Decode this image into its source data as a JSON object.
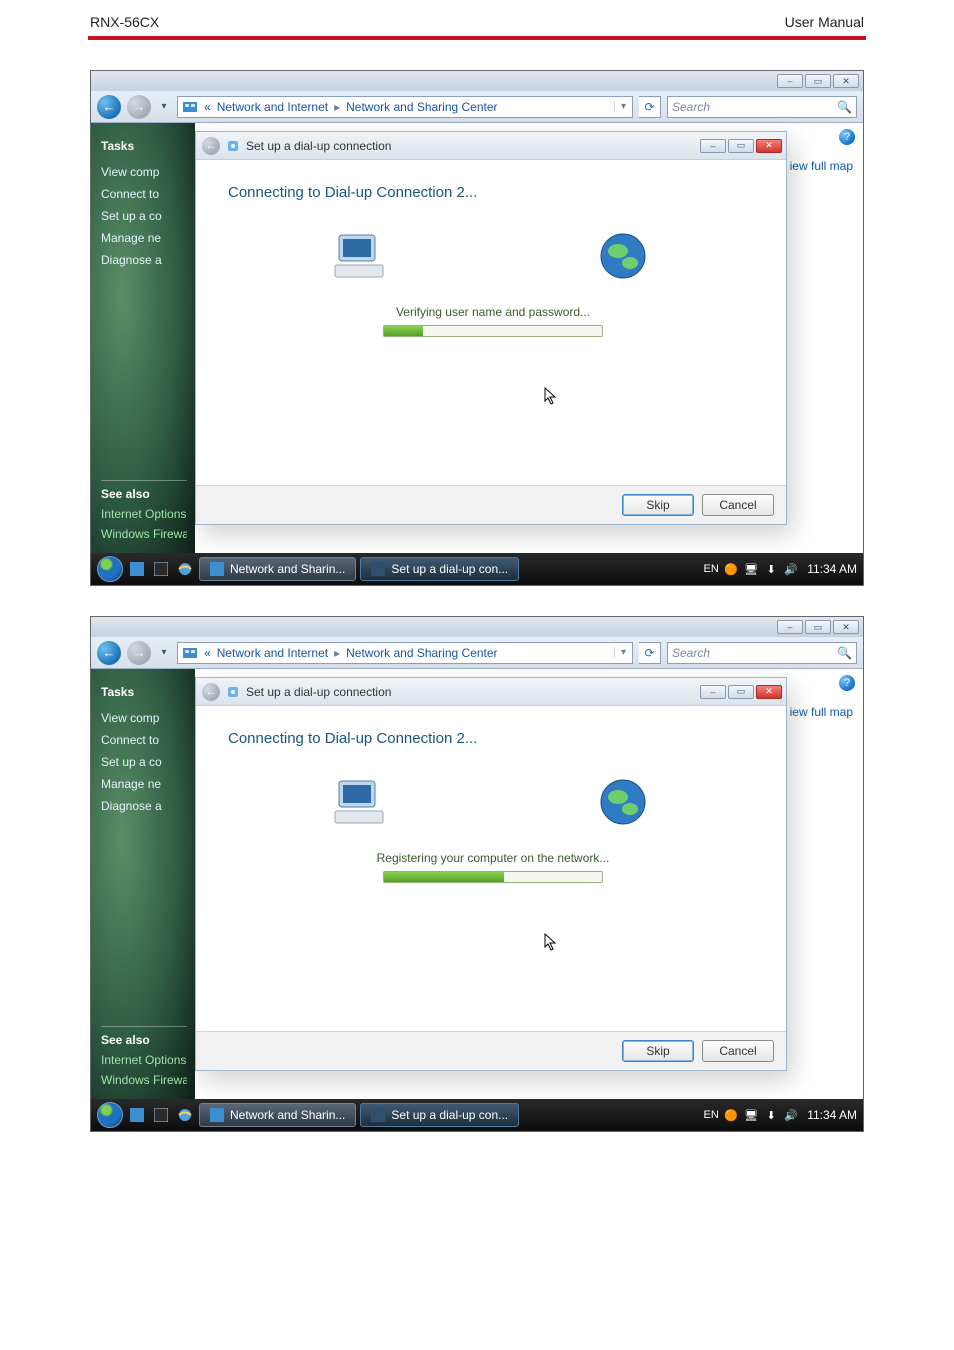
{
  "doc": {
    "device": "RNX-56CX",
    "section": "User Manual"
  },
  "windows": [
    {
      "addrbar": {
        "root_marker": "«",
        "path1": "Network and Internet",
        "path2": "Network and Sharing Center",
        "arrow": "▸"
      },
      "search_placeholder": "Search",
      "sidebar": {
        "heading": "Tasks",
        "items": [
          "View comp",
          "Connect to",
          "Set up a co",
          "Manage ne",
          "Diagnose a"
        ],
        "seealso_heading": "See also",
        "seealso": [
          "Internet Options",
          "Windows Firewall"
        ]
      },
      "fullmap_link": "iew full map",
      "help_char": "?",
      "dialog": {
        "title": "Set up a dial-up connection",
        "heading": "Connecting to Dial-up Connection 2...",
        "status": "Verifying user name and password...",
        "progress_pct": 18,
        "skip_label": "Skip",
        "cancel_label": "Cancel"
      },
      "taskbar": {
        "btn1": "Network and Sharin...",
        "btn2": "Set up a dial-up con...",
        "clock": "11:34 AM"
      }
    },
    {
      "addrbar": {
        "root_marker": "«",
        "path1": "Network and Internet",
        "path2": "Network and Sharing Center",
        "arrow": "▸"
      },
      "search_placeholder": "Search",
      "sidebar": {
        "heading": "Tasks",
        "items": [
          "View comp",
          "Connect to",
          "Set up a co",
          "Manage ne",
          "Diagnose a"
        ],
        "seealso_heading": "See also",
        "seealso": [
          "Internet Options",
          "Windows Firewall"
        ]
      },
      "fullmap_link": "iew full map",
      "help_char": "?",
      "dialog": {
        "title": "Set up a dial-up connection",
        "heading": "Connecting to Dial-up Connection 2...",
        "status": "Registering your computer on the network...",
        "progress_pct": 55,
        "skip_label": "Skip",
        "cancel_label": "Cancel"
      },
      "taskbar": {
        "btn1": "Network and Sharin...",
        "btn2": "Set up a dial-up con...",
        "clock": "11:34 AM"
      }
    }
  ],
  "icons": {
    "back": "←",
    "forward": "→",
    "drop": "▾",
    "refresh": "⟳",
    "min": "–",
    "max": "▭",
    "close": "✕",
    "search": "🔍",
    "lang": "EN",
    "shield": "🛡",
    "net": "⬚",
    "vol": "🔊",
    "phone": "☎"
  }
}
